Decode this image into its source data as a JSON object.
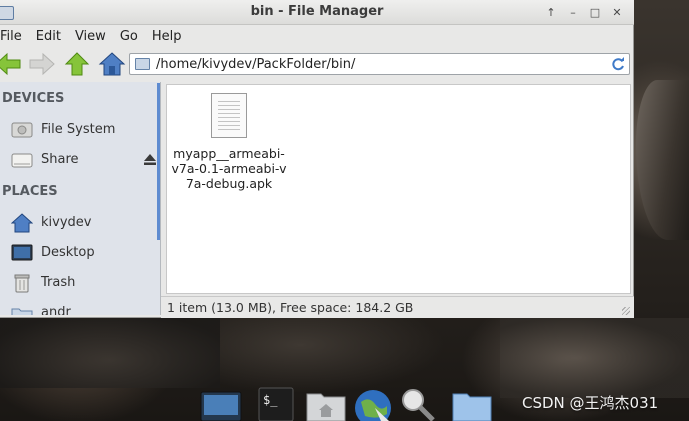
{
  "window": {
    "title": "bin - File Manager",
    "controls": [
      "↑",
      "–",
      "□",
      "✕"
    ]
  },
  "menu": {
    "items": [
      "File",
      "Edit",
      "View",
      "Go",
      "Help"
    ]
  },
  "toolbar": {
    "address": "/home/kivydev/PackFolder/bin/"
  },
  "sidebar": {
    "devices_header": "DEVICES",
    "devices": [
      {
        "label": "File System",
        "icon": "hard-drive-icon"
      },
      {
        "label": "Share",
        "icon": "drive-icon"
      }
    ],
    "places_header": "PLACES",
    "places": [
      {
        "label": "kivydev",
        "icon": "home-icon"
      },
      {
        "label": "Desktop",
        "icon": "desktop-icon"
      },
      {
        "label": "Trash",
        "icon": "trash-icon"
      },
      {
        "label": "andr",
        "icon": "folder-icon"
      }
    ]
  },
  "files": [
    {
      "name": "myapp__armeabi-v7a-0.1-armeabi-v7a-debug.apk",
      "icon": "document-icon"
    }
  ],
  "status": {
    "text": "1 item (13.0 MB), Free space: 184.2 GB"
  },
  "dock": {
    "items": [
      {
        "icon": "desktop-icon"
      },
      {
        "icon": "terminal-icon",
        "label": "$_"
      },
      {
        "icon": "home-folder-icon"
      },
      {
        "icon": "web-browser-icon"
      },
      {
        "icon": "search-icon"
      },
      {
        "icon": "folder-icon"
      }
    ]
  },
  "watermark": "CSDN @王鸿杰031",
  "colors": {
    "accent": "#5e8bd0",
    "sidebar_bg": "#dfe3ea",
    "arrow_green": "#7fc02e"
  }
}
